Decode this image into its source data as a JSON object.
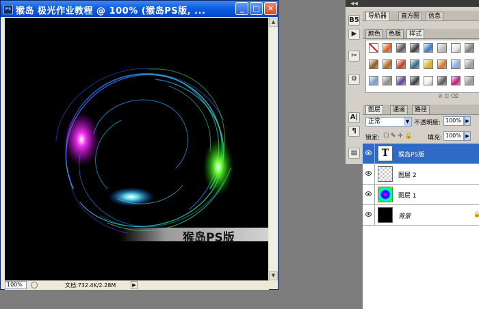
{
  "window": {
    "title": "猴岛 极光作业教程 @ 100% (猴岛PS版, ...",
    "app_icon_label": "PS",
    "buttons": {
      "minimize": "_",
      "maximize": "□",
      "close": "✕"
    }
  },
  "canvas": {
    "watermark": "猴岛PS版"
  },
  "statusbar": {
    "zoom": "100%",
    "doc_info": "文档:732.4K/2.28M"
  },
  "toolstrip": {
    "tools": [
      "B5",
      "▶",
      "✂",
      "⚙",
      "A|",
      "¶",
      "▤"
    ]
  },
  "panels": {
    "nav_tabs": [
      "导航器",
      "直方图",
      "信息"
    ],
    "style_tabs": [
      "颜色",
      "色板",
      "样式"
    ],
    "layer_tabs": [
      "图层",
      "通道",
      "路径"
    ]
  },
  "layers_panel": {
    "blend_mode": "正常",
    "opacity_label": "不透明度:",
    "opacity_value": "100%",
    "lock_label": "锁定:",
    "fill_label": "填充:",
    "fill_value": "100%",
    "layers": [
      {
        "name": "猴岛PS版",
        "thumb": "T",
        "selected": true
      },
      {
        "name": "图层 2",
        "thumb": "transparent"
      },
      {
        "name": "图层 1",
        "thumb": "color"
      },
      {
        "name": "背景",
        "thumb": "black",
        "locked": true
      }
    ]
  },
  "style_swatches": [
    "#ffffff",
    "#e05a1a",
    "#555555",
    "#3a3a3a",
    "#3b78c8",
    "#bdbdbd",
    "#e8e8e8",
    "#7a7a7a",
    "#8a5a18",
    "#a86a20",
    "#c83a2a",
    "#2a6a8a",
    "#e0b020",
    "#d07a20",
    "#88b0e0",
    "#a0a0a0",
    "#7aa0d0",
    "#8a8a8a",
    "#6040a0",
    "#3a3a3a",
    "#f0f0f0",
    "#5a5a5a",
    "#c01880",
    "#9a9a9a"
  ]
}
